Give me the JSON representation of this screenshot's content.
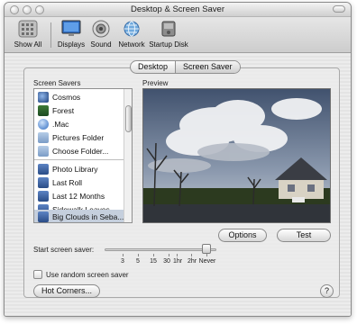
{
  "window": {
    "title": "Desktop & Screen Saver"
  },
  "toolbar": {
    "items": [
      {
        "label": "Show All",
        "icon": "apple-grid-icon"
      },
      {
        "label": "Displays",
        "icon": "monitor-icon"
      },
      {
        "label": "Sound",
        "icon": "speaker-icon"
      },
      {
        "label": "Network",
        "icon": "globe-icon"
      },
      {
        "label": "Startup Disk",
        "icon": "disk-icon"
      }
    ]
  },
  "tabs": [
    {
      "label": "Desktop",
      "selected": false
    },
    {
      "label": "Screen Saver",
      "selected": true
    }
  ],
  "screen_savers": {
    "label": "Screen Savers",
    "items": [
      {
        "label": "Cosmos",
        "icon": "cosmos-icon"
      },
      {
        "label": "Forest",
        "icon": "forest-icon"
      },
      {
        "label": ".Mac",
        "icon": "dotmac-icon"
      },
      {
        "label": "Pictures Folder",
        "icon": "pictures-folder-icon"
      },
      {
        "label": "Choose Folder...",
        "icon": "choose-folder-icon"
      },
      {
        "label": "Photo Library",
        "icon": "photo-library-icon"
      },
      {
        "label": "Last Roll",
        "icon": "last-roll-icon"
      },
      {
        "label": "Last 12 Months",
        "icon": "last-12-months-icon"
      },
      {
        "label": "Sidewalk Leaves",
        "icon": "album-icon"
      },
      {
        "label": "Big Clouds in Seba...",
        "icon": "album-icon",
        "selected": true
      }
    ]
  },
  "preview": {
    "label": "Preview"
  },
  "buttons": {
    "options": "Options",
    "test": "Test",
    "hot_corners": "Hot Corners...",
    "help": "?"
  },
  "start_saver": {
    "label": "Start screen saver:",
    "ticks": [
      "3",
      "5",
      "15",
      "30",
      "1hr",
      "2hr",
      "Never"
    ],
    "value": "Never"
  },
  "random_saver": {
    "label": "Use random screen saver",
    "checked": false
  },
  "colors": {
    "selection": "#c5cfdd",
    "window_bg": "#e9e9e9",
    "accent": "#2f6cc0"
  }
}
